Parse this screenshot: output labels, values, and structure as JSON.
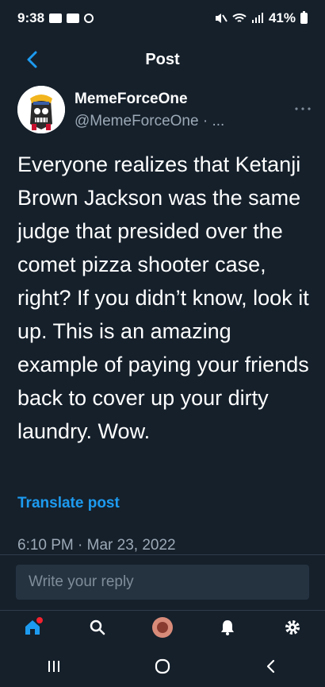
{
  "status_bar": {
    "time": "9:38",
    "battery": "41%"
  },
  "header": {
    "title": "Post"
  },
  "author": {
    "name": "MemeForceOne",
    "handle": "@MemeForceOne · ..."
  },
  "post": {
    "text": "Everyone realizes that Ketanji Brown Jackson was the same judge that presided over the comet pizza shooter case, right? If you didn’t know, look it up. This is an amazing example of paying your friends back to cover up your dirty laundry. Wow.",
    "translate_label": "Translate post",
    "timestamp": "6:10 PM · Mar 23, 2022"
  },
  "reply": {
    "placeholder": "Write your reply"
  },
  "colors": {
    "background": "#15202b",
    "accent": "#1d9bf0",
    "muted": "#9ca9b6",
    "notification_dot": "#f4212e"
  },
  "icons": {
    "back": "chevron-left-icon",
    "more": "more-horizontal-icon",
    "home": "home-icon",
    "search": "search-icon",
    "profile": "profile-avatar",
    "notifications": "bell-icon",
    "settings": "gear-icon",
    "recents": "recents-icon",
    "home_system": "home-circle-icon",
    "back_system": "back-icon"
  }
}
